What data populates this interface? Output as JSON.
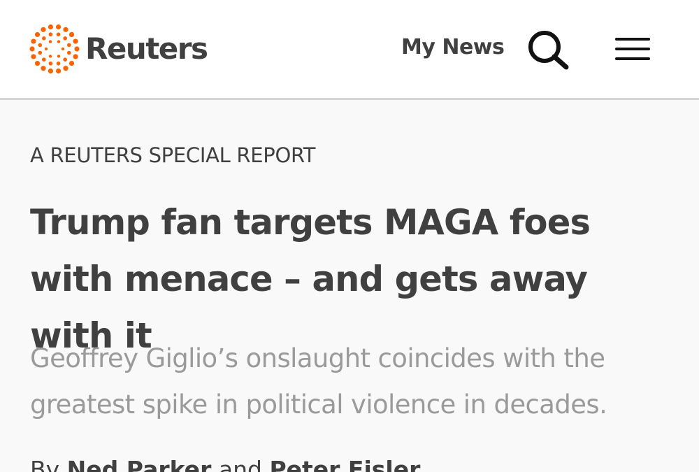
{
  "header": {
    "logo_text": "Reuters",
    "my_news_label": "My News",
    "brand_color": "#fa6400",
    "search_icon": "search-icon",
    "menu_icon": "hamburger-menu-icon"
  },
  "article": {
    "kicker": "A REUTERS SPECIAL REPORT",
    "headline": "Trump fan targets MAGA foes with menace – and gets away with it",
    "dek": "Geoffrey Giglio’s onslaught coincides with the greatest spike in political violence in decades.",
    "byline": {
      "prefix": "By",
      "author_1": "Ned Parker",
      "joiner": "and",
      "author_2": "Peter Eisler"
    }
  }
}
